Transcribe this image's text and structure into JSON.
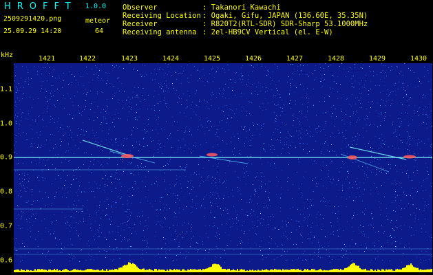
{
  "header": {
    "title": "HROFFT",
    "version": "1.0.0",
    "filename": "2509291420.png",
    "mode": "meteor",
    "datetime": "25.09.29 14:20",
    "count": "64"
  },
  "info": [
    {
      "key": "Observer",
      "value": ": Takanori Kawachi"
    },
    {
      "key": "Receiving Location",
      "value": ": Ogaki, Gifu, JAPAN (136.60E, 35.35N)"
    },
    {
      "key": "Receiver",
      "value": ": R820T2(RTL-SDR) SDR-Sharp 53.1000MHz"
    },
    {
      "key": "Receiving antenna",
      "value": ": 2el-HB9CV Vertical (el. E-W)"
    }
  ],
  "plot": {
    "unit": "kHz",
    "x_ticks": [
      "1421",
      "1422",
      "1423",
      "1424",
      "1425",
      "1426",
      "1427",
      "1428",
      "1429",
      "1430"
    ],
    "y_ticks": [
      "1.1",
      "1.0",
      "0.9",
      "0.8",
      "0.7",
      "0.6"
    ],
    "colors": {
      "background": "#0d1a8a",
      "noise_a": "#2a6bff",
      "noise_b": "#59d3ff",
      "carrier": "#7fffff",
      "echo": "#ff5a5a",
      "baseline": "#ffff00",
      "axis_text": "#ffff00"
    }
  }
}
